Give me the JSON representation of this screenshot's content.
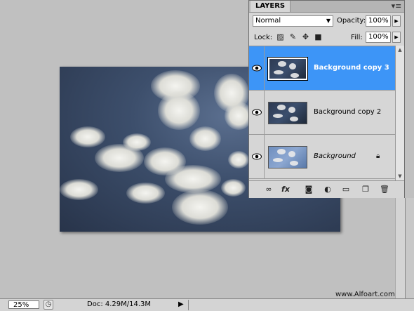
{
  "layers_panel": {
    "tab_label": "LAYERS",
    "panel_menu_icon": "panel-menu-icon",
    "blend_mode": "Normal",
    "opacity_label": "Opacity:",
    "opacity_value": "100%",
    "lock_label": "Lock:",
    "fill_label": "Fill:",
    "fill_value": "100%",
    "layers": [
      {
        "name": "Background copy 3",
        "selected": true,
        "visible": true,
        "locked": false
      },
      {
        "name": "Background copy 2",
        "selected": false,
        "visible": true,
        "locked": false
      },
      {
        "name": "Background",
        "selected": false,
        "visible": true,
        "locked": true
      }
    ],
    "footer_icons": [
      "link-layers-icon",
      "fx-icon",
      "add-mask-icon",
      "adjustment-layer-icon",
      "new-group-icon",
      "new-layer-icon",
      "trash-icon"
    ],
    "fx_label": "fx"
  },
  "status_bar": {
    "zoom": "25%",
    "doc_info": "Doc: 4.29M/14.3M"
  },
  "watermark": "www.Alfoart.com",
  "colors": {
    "selection": "#3d95f7",
    "workspace": "#c0c0c0"
  }
}
